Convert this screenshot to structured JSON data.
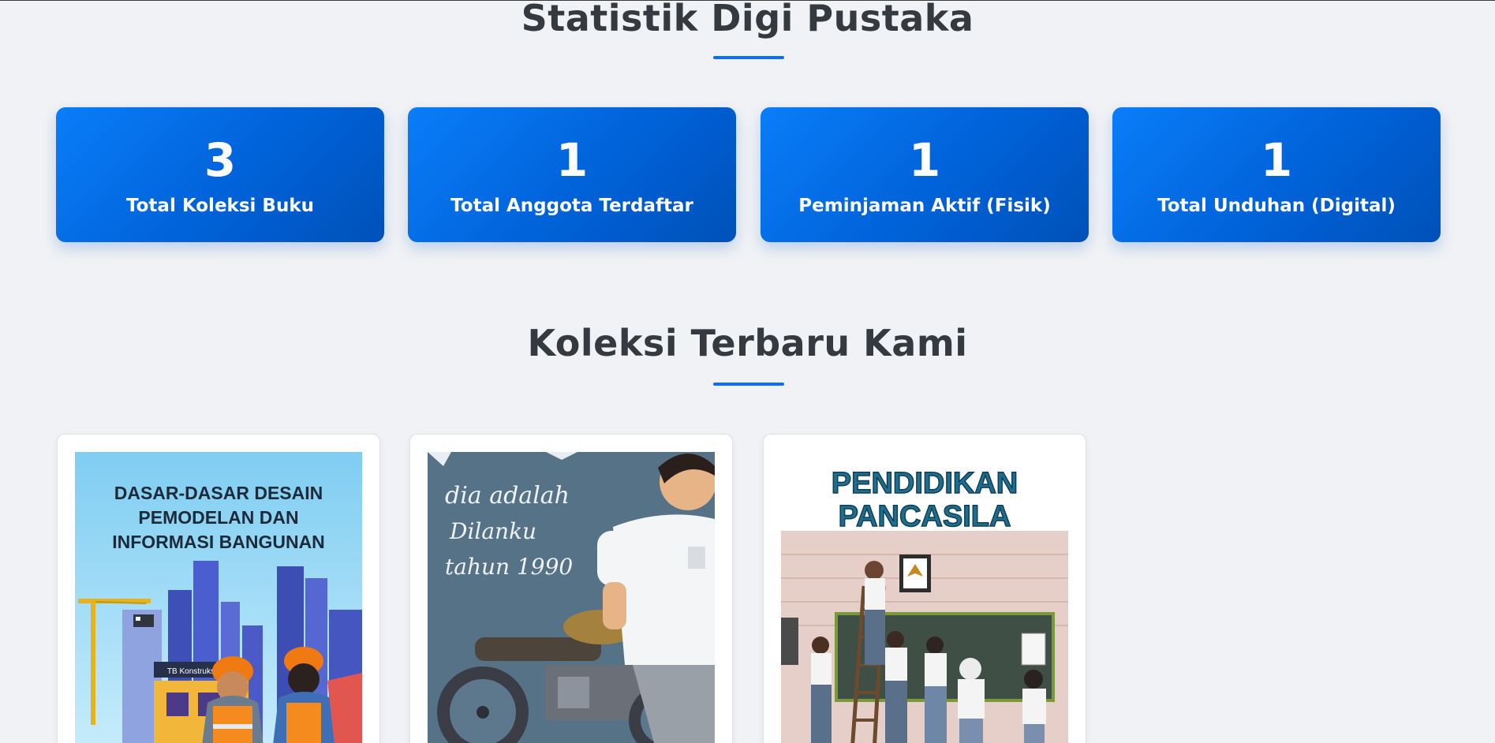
{
  "statistics": {
    "title": "Statistik Digi Pustaka",
    "cards": [
      {
        "value": "3",
        "label": "Total Koleksi Buku"
      },
      {
        "value": "1",
        "label": "Total Anggota Terdaftar"
      },
      {
        "value": "1",
        "label": "Peminjaman Aktif (Fisik)"
      },
      {
        "value": "1",
        "label": "Total Unduhan (Digital)"
      }
    ]
  },
  "collection": {
    "title": "Koleksi Terbaru Kami",
    "books": [
      {
        "cover_lines": [
          "DASAR-DASAR DESAIN",
          "PEMODELAN DAN",
          "INFORMASI BANGUNAN"
        ],
        "cover_sign": "TB Konstruksi Jaya"
      },
      {
        "cover_lines": [
          "dia adalah",
          "Dilanku",
          "tahun 1990"
        ]
      },
      {
        "cover_lines": [
          "PENDIDIKAN",
          "PANCASILA"
        ]
      }
    ]
  },
  "colors": {
    "accent": "#0d6efd",
    "background": "#f0f2f5",
    "heading": "#343a40"
  }
}
